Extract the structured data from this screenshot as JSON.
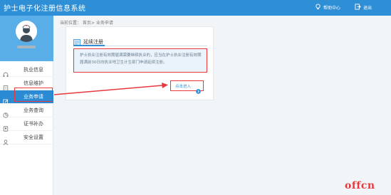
{
  "header": {
    "title": "护士电子化注册信息系统",
    "help_label": "帮助中心",
    "logout_label": "退出"
  },
  "sidebar": {
    "items": [
      {
        "label": "执业信息",
        "icon": "headset-icon",
        "active": false
      },
      {
        "label": "信息维护",
        "icon": "document-icon",
        "active": false
      },
      {
        "label": "业务申请",
        "icon": "edit-icon",
        "active": true
      },
      {
        "label": "业务查询",
        "icon": "chart-icon",
        "active": false
      },
      {
        "label": "证书补办",
        "icon": "certificate-icon",
        "active": false
      },
      {
        "label": "安全设置",
        "icon": "user-icon",
        "active": false
      }
    ]
  },
  "breadcrumb": "当前位置： 首页> 业务申请",
  "card": {
    "title": "延续注册",
    "notice": "护士执业注册有效期届满需要继续执业的，应当在护士执业注册有效期届满前30日向执业地卫生计生部门申请延续注册。",
    "enter_label": "点击进入"
  },
  "watermark": "offcn",
  "colors": {
    "primary": "#2f8fd6",
    "highlight_red": "#e8383d",
    "profile_bg": "#5aaee8"
  }
}
